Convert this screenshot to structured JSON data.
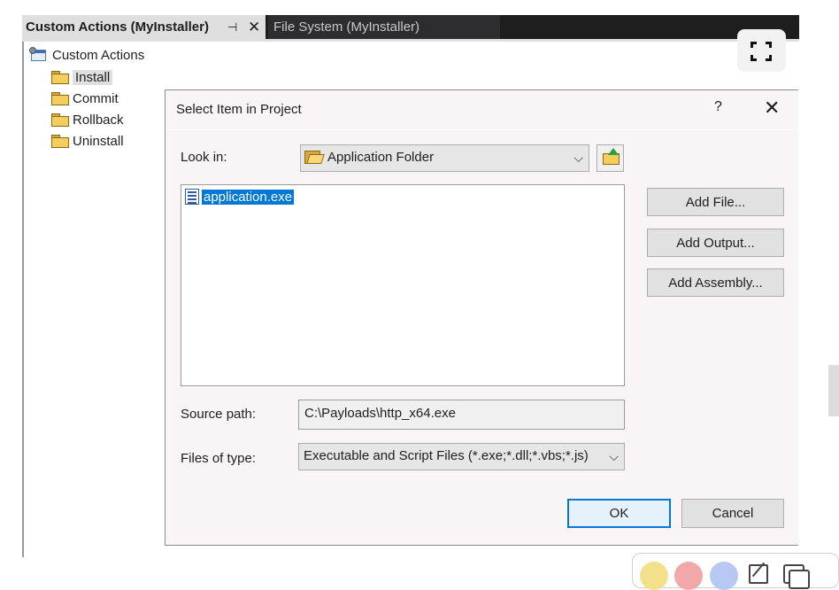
{
  "tabs": {
    "active_label": "Custom Actions (MyInstaller)",
    "pin_glyph": "⊣",
    "close_glyph": "✕",
    "inactive_label": "File System (MyInstaller)"
  },
  "tree": {
    "root": "Custom Actions",
    "items": [
      {
        "label": "Install",
        "selected": true
      },
      {
        "label": "Commit"
      },
      {
        "label": "Rollback"
      },
      {
        "label": "Uninstall"
      }
    ]
  },
  "dialog": {
    "title": "Select Item in Project",
    "help_glyph": "?",
    "close_glyph": "✕",
    "look_in_label": "Look in:",
    "look_in_value": "Application Folder",
    "files": [
      {
        "name": "application.exe",
        "selected": true
      }
    ],
    "buttons": {
      "add_file": "Add File...",
      "add_output": "Add Output...",
      "add_assembly": "Add Assembly..."
    },
    "source_path_label": "Source path:",
    "source_path_value": "C:\\Payloads\\http_x64.exe",
    "files_of_type_label": "Files of type:",
    "files_of_type_value": "Executable and Script Files (*.exe;*.dll;*.vbs;*.js)",
    "ok": "OK",
    "cancel": "Cancel"
  },
  "colors": {
    "selection": "#0078d7",
    "tab_bar": "#1e1e1e",
    "dialog_bg": "#f9f4f6",
    "palette": [
      "#f3e08a",
      "#f2a8a8",
      "#b7c9f2"
    ]
  }
}
